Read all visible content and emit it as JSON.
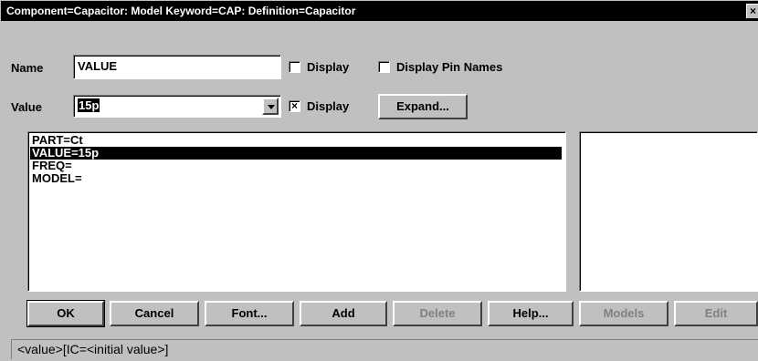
{
  "window": {
    "title": "Component=Capacitor: Model Keyword=CAP: Definition=Capacitor",
    "close_symbol": "×"
  },
  "name_row": {
    "label": "Name",
    "value": "VALUE",
    "display_label": "Display",
    "display_checked": false,
    "display_pin_names_label": "Display Pin Names",
    "display_pin_names_checked": false
  },
  "value_row": {
    "label": "Value",
    "value": "15p",
    "display_label": "Display",
    "display_checked": true,
    "check_mark": "×",
    "expand_label": "Expand..."
  },
  "attribute_list": {
    "items": [
      "PART=Ct",
      "VALUE=15p",
      "FREQ=",
      "MODEL="
    ],
    "selected_index": 1
  },
  "buttons": {
    "ok": "OK",
    "cancel": "Cancel",
    "font": "Font...",
    "add": "Add",
    "delete": "Delete",
    "help": "Help...",
    "models": "Models",
    "edit": "Edit"
  },
  "status": {
    "text": "<value>[IC=<initial value>]"
  },
  "icons": [
    "close-icon",
    "dropdown-arrow-icon",
    "checkbox-icon"
  ]
}
